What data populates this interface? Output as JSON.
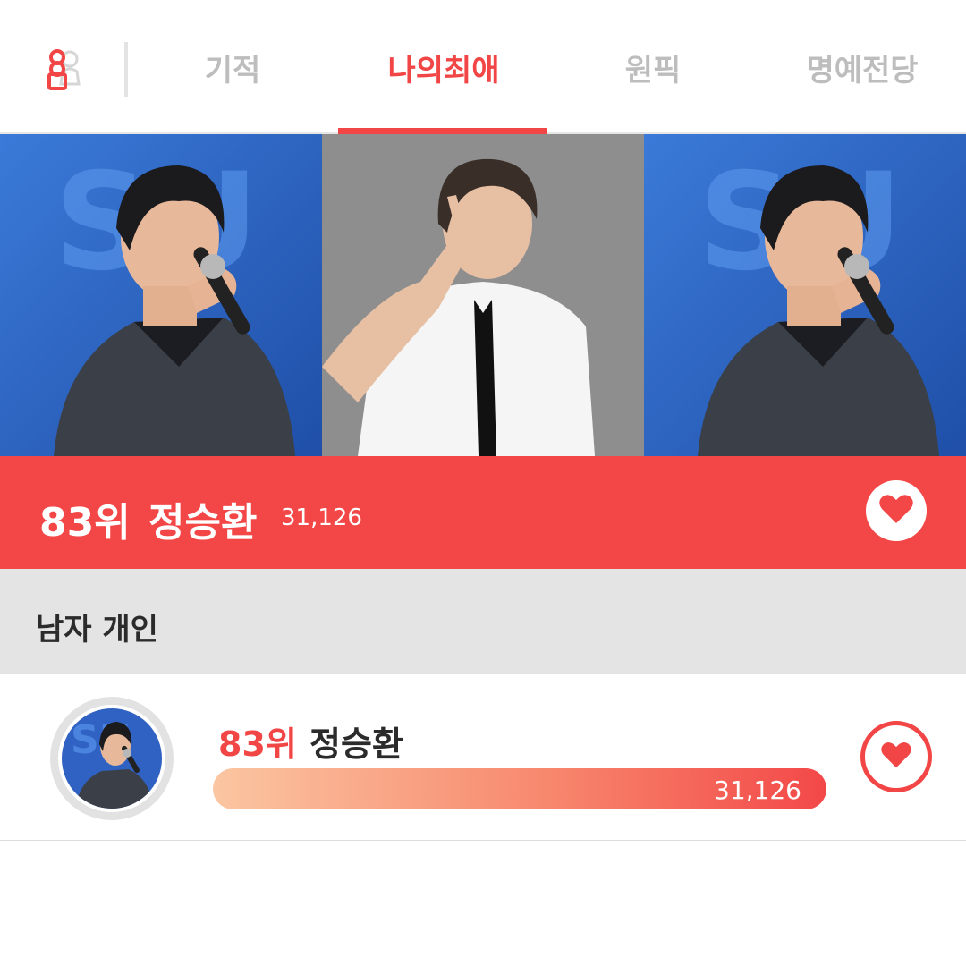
{
  "nav": {
    "tabs": [
      {
        "label": "기적"
      },
      {
        "label": "나의최애"
      },
      {
        "label": "원픽"
      },
      {
        "label": "명예전당"
      }
    ],
    "active_tab": "나의최애",
    "accent_color": "#f24646"
  },
  "banner": {
    "rank": "83위",
    "name": "정승환",
    "score": "31,126",
    "background_color": "#f34747"
  },
  "section": {
    "title": "남자 개인"
  },
  "ranking_list": [
    {
      "rank": "83위",
      "name": "정승환",
      "score": "31,126",
      "bar_fill_percent": 100
    }
  ],
  "icons": {
    "logo": "person-pin-icon",
    "banner_vote": "heart-icon",
    "row_vote": "heart-icon"
  }
}
